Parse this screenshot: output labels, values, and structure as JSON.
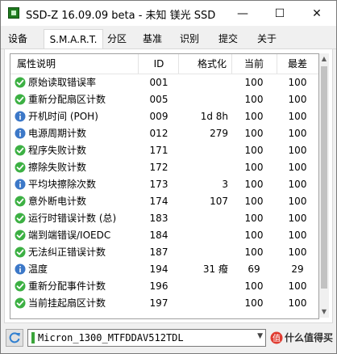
{
  "window": {
    "title": "SSD-Z 16.09.09 beta - 未知 镁光 SSD",
    "minimize_label": "—",
    "maximize_label": "☐",
    "close_label": "✕"
  },
  "tabs": [
    {
      "label": "设备",
      "active": false
    },
    {
      "label": "S.M.A.R.T.",
      "active": true
    },
    {
      "label": "分区",
      "active": false
    },
    {
      "label": "基准",
      "active": false
    },
    {
      "label": "识别",
      "active": false
    },
    {
      "label": "提交",
      "active": false
    },
    {
      "label": "关于",
      "active": false
    }
  ],
  "smart": {
    "columns": {
      "name": "属性说明",
      "id": "ID",
      "raw": "格式化",
      "current": "当前",
      "worst": "最差"
    },
    "rows": [
      {
        "status": "ok",
        "name": "原始读取错误率",
        "id": "001",
        "raw": "",
        "current": "100",
        "worst": "100"
      },
      {
        "status": "ok",
        "name": "重新分配扇区计数",
        "id": "005",
        "raw": "",
        "current": "100",
        "worst": "100"
      },
      {
        "status": "info",
        "name": "开机时间 (POH)",
        "id": "009",
        "raw": "1d 8h",
        "current": "100",
        "worst": "100"
      },
      {
        "status": "info",
        "name": "电源周期计数",
        "id": "012",
        "raw": "279",
        "current": "100",
        "worst": "100"
      },
      {
        "status": "ok",
        "name": "程序失败计数",
        "id": "171",
        "raw": "",
        "current": "100",
        "worst": "100"
      },
      {
        "status": "ok",
        "name": "擦除失败计数",
        "id": "172",
        "raw": "",
        "current": "100",
        "worst": "100"
      },
      {
        "status": "info",
        "name": "平均块擦除次数",
        "id": "173",
        "raw": "3",
        "current": "100",
        "worst": "100"
      },
      {
        "status": "ok",
        "name": "意外断电计数",
        "id": "174",
        "raw": "107",
        "current": "100",
        "worst": "100"
      },
      {
        "status": "ok",
        "name": "运行时错误计数 (总)",
        "id": "183",
        "raw": "",
        "current": "100",
        "worst": "100"
      },
      {
        "status": "ok",
        "name": "端到端错误/IOEDC",
        "id": "184",
        "raw": "",
        "current": "100",
        "worst": "100"
      },
      {
        "status": "ok",
        "name": "无法纠正错误计数",
        "id": "187",
        "raw": "",
        "current": "100",
        "worst": "100"
      },
      {
        "status": "info",
        "name": "温度",
        "id": "194",
        "raw": "31 癈",
        "current": "69",
        "worst": "29"
      },
      {
        "status": "ok",
        "name": "重新分配事件计数",
        "id": "196",
        "raw": "",
        "current": "100",
        "worst": "100"
      },
      {
        "status": "ok",
        "name": "当前挂起扇区计数",
        "id": "197",
        "raw": "",
        "current": "100",
        "worst": "100"
      }
    ]
  },
  "drive_selector": {
    "value": "Micron_1300_MTFDDAV512TDL"
  },
  "watermark": {
    "text": "值 什么值得买"
  },
  "colors": {
    "ok": "#3cb043",
    "info": "#3c78c8",
    "accent": "#1f7a1f"
  }
}
